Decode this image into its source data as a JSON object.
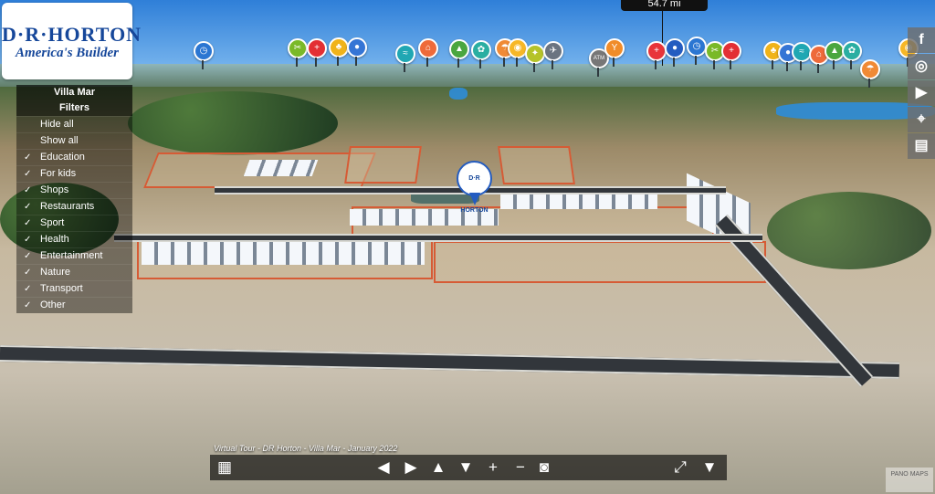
{
  "logo": {
    "main": "D·R·HORTON",
    "sub": "America's Builder"
  },
  "sidebar": {
    "title": "Villa Mar",
    "filters_label": "Filters",
    "hide_all": "Hide all",
    "show_all": "Show all",
    "items": [
      {
        "label": "Education",
        "checked": true
      },
      {
        "label": "For kids",
        "checked": true
      },
      {
        "label": "Shops",
        "checked": true
      },
      {
        "label": "Restaurants",
        "checked": true
      },
      {
        "label": "Sport",
        "checked": true
      },
      {
        "label": "Health",
        "checked": true
      },
      {
        "label": "Entertainment",
        "checked": true
      },
      {
        "label": "Nature",
        "checked": true
      },
      {
        "label": "Transport",
        "checked": true
      },
      {
        "label": "Other",
        "checked": true
      }
    ]
  },
  "distance_label": "54.7 mi",
  "center_pin_label": "D·R HORTON",
  "caption": "Virtual Tour - DR Horton - Villa Mar - January 2022",
  "pins": [
    {
      "name": "poi-shop-icon",
      "glyph": "◷",
      "color": "#2b76d2"
    },
    {
      "name": "poi-restaurant-icon",
      "glyph": "✂",
      "color": "#7ab928"
    },
    {
      "name": "poi-health-icon",
      "glyph": "+",
      "color": "#e32f34"
    },
    {
      "name": "poi-entertainment-icon",
      "glyph": "♣",
      "color": "#f0b31a"
    },
    {
      "name": "poi-education-icon",
      "glyph": "●",
      "color": "#3575d5"
    },
    {
      "name": "poi-water-icon",
      "glyph": "≈",
      "color": "#20a7b3"
    },
    {
      "name": "poi-shopping-cart-icon",
      "glyph": "⌂",
      "color": "#ee6a3a"
    },
    {
      "name": "poi-tree-icon",
      "glyph": "▲",
      "color": "#4aa63f"
    },
    {
      "name": "poi-nature-icon",
      "glyph": "✿",
      "color": "#2aaea2"
    },
    {
      "name": "poi-beach-icon",
      "glyph": "☂",
      "color": "#f08a35"
    },
    {
      "name": "poi-camera-icon",
      "glyph": "◉",
      "color": "#f7b727"
    },
    {
      "name": "poi-kids-icon",
      "glyph": "✦",
      "color": "#b5c329"
    },
    {
      "name": "poi-airport-icon",
      "glyph": "✈",
      "color": "#6b7480"
    },
    {
      "name": "poi-atm-icon",
      "glyph": "ATM",
      "color": "#777777"
    },
    {
      "name": "poi-food-icon",
      "glyph": "Y",
      "color": "#f08c29"
    },
    {
      "name": "poi-hospital-icon",
      "glyph": "+",
      "color": "#e8343a"
    },
    {
      "name": "poi-marker-icon",
      "glyph": "●",
      "color": "#245cc0"
    }
  ],
  "social": [
    {
      "name": "facebook-icon",
      "glyph": "f"
    },
    {
      "name": "instagram-icon",
      "glyph": "◎"
    },
    {
      "name": "youtube-icon",
      "glyph": "▶"
    },
    {
      "name": "map-icon",
      "glyph": "⌖"
    },
    {
      "name": "book-icon",
      "glyph": "▤"
    }
  ],
  "toolbar": [
    {
      "name": "grid-menu-button",
      "glyph": "▦"
    },
    {
      "name": "left-arrow-button",
      "glyph": "◀"
    },
    {
      "name": "right-arrow-button",
      "glyph": "▶"
    },
    {
      "name": "up-arrow-button",
      "glyph": "▲"
    },
    {
      "name": "down-arrow-button",
      "glyph": "▼"
    },
    {
      "name": "zoom-in-button",
      "glyph": "+"
    },
    {
      "name": "zoom-out-button",
      "glyph": "−"
    },
    {
      "name": "vr-button",
      "glyph": "◙"
    },
    {
      "name": "fullscreen-button",
      "glyph": "⤢"
    },
    {
      "name": "collapse-toolbar-button",
      "glyph": "▼"
    }
  ],
  "brand": "PANO MAPS"
}
